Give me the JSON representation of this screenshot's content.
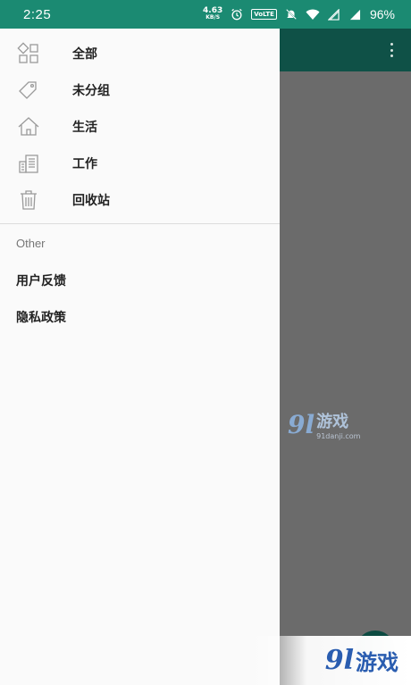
{
  "status_bar": {
    "time": "2:25",
    "net_speed_value": "4.63",
    "net_speed_unit": "KB/S",
    "volte_label": "VoLTE",
    "battery": "96%"
  },
  "drawer": {
    "items": [
      {
        "label": "全部",
        "icon": "grid-icon"
      },
      {
        "label": "未分组",
        "icon": "tag-icon"
      },
      {
        "label": "生活",
        "icon": "home-icon"
      },
      {
        "label": "工作",
        "icon": "building-icon"
      },
      {
        "label": "回收站",
        "icon": "trash-icon"
      }
    ],
    "section_header": "Other",
    "other_items": [
      {
        "label": "用户反馈"
      },
      {
        "label": "隐私政策"
      }
    ]
  },
  "watermark": {
    "logo": "9l",
    "name": "游戏",
    "url": "91danji.com"
  },
  "colors": {
    "status_bar": "#1b8a72",
    "app_bar": "#0f5147",
    "scrim": "#6b6b6b",
    "drawer_bg": "#fafafa"
  }
}
